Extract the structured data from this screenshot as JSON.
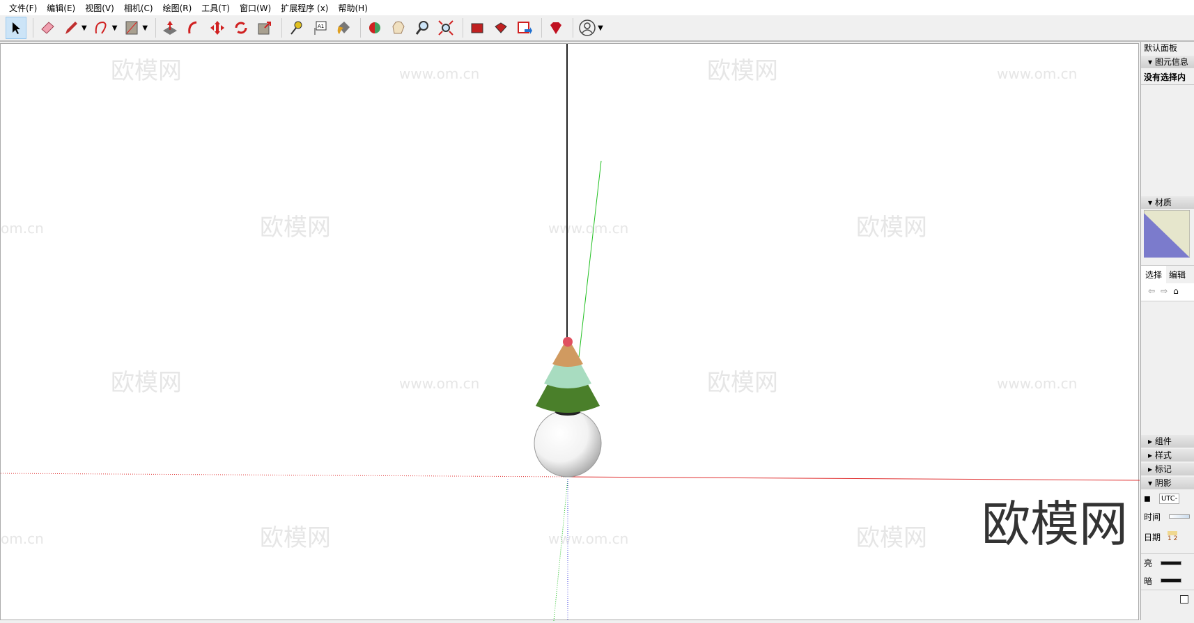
{
  "menu": [
    "文件(F)",
    "编辑(E)",
    "视图(V)",
    "相机(C)",
    "绘图(R)",
    "工具(T)",
    "窗口(W)",
    "扩展程序 (x)",
    "帮助(H)"
  ],
  "toolbar": {
    "tools": [
      "select-icon",
      "eraser-icon",
      "pencil-icon",
      "arc-icon",
      "rectangle-icon",
      "pushpull-icon",
      "followme-icon",
      "move-icon",
      "rotate-icon",
      "scale-icon",
      "tape-measure-icon",
      "text-icon",
      "paint-bucket-icon",
      "orbit-icon",
      "pan-icon",
      "zoom-icon",
      "zoom-extents-icon",
      "warehouse-icon",
      "extension-warehouse-icon",
      "send-to-layout-icon",
      "ruby-icon",
      "account-icon"
    ]
  },
  "watermarks": {
    "logo": "欧模网",
    "url": "www.om.cn",
    "partial_url": "om.cn"
  },
  "panel": {
    "title": "默认面板",
    "entity_info": "图元信息",
    "no_selection": "没有选择内",
    "materials": "材质",
    "tab_select": "选择",
    "tab_edit": "编辑",
    "components": "组件",
    "styles": "样式",
    "tags": "标记",
    "shadows": "阴影",
    "utc": "UTC-",
    "time": "时间",
    "date": "日期",
    "date_ticks": "1 2",
    "light": "亮",
    "dark": "暗"
  },
  "colors": {
    "x_axis": "#e03030",
    "y_axis": "#20c020",
    "material_a": "#7b7bcc",
    "material_b": "#e6e6cc"
  }
}
